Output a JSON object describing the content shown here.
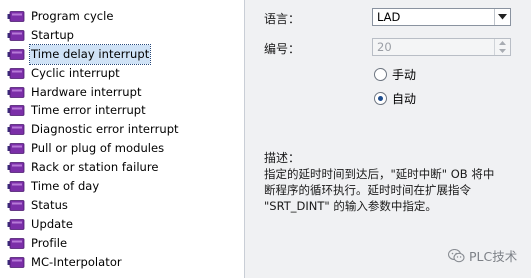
{
  "ob_list": {
    "items": [
      {
        "label": "Program cycle"
      },
      {
        "label": "Startup"
      },
      {
        "label": "Time delay interrupt",
        "selected": true
      },
      {
        "label": "Cyclic interrupt"
      },
      {
        "label": "Hardware interrupt"
      },
      {
        "label": "Time error interrupt"
      },
      {
        "label": "Diagnostic error interrupt"
      },
      {
        "label": "Pull or plug of modules"
      },
      {
        "label": "Rack or station failure"
      },
      {
        "label": "Time of day"
      },
      {
        "label": "Status"
      },
      {
        "label": "Update"
      },
      {
        "label": "Profile"
      },
      {
        "label": "MC-Interpolator"
      }
    ],
    "icon": "ob-block-icon"
  },
  "properties": {
    "language_label": "语言：",
    "language_value": "LAD",
    "number_label": "编号：",
    "number_value": "20",
    "manual_label": "手动",
    "auto_label": "自动",
    "numbering_mode": "auto",
    "description_label": "描述：",
    "description_lines": [
      "指定的延时时间到达后，\"延时中断\" OB 将中",
      "断程序的循环执行。延时时间在扩展指令",
      "\"SRT_DINT\" 的输入参数中指定。"
    ]
  },
  "watermark": {
    "text": "PLC技术",
    "icon": "wechat-icon"
  },
  "colors": {
    "selection": "#cfe2f6",
    "panel_bg": "#f0f1f3",
    "icon_purple": "#7b2fa8"
  }
}
